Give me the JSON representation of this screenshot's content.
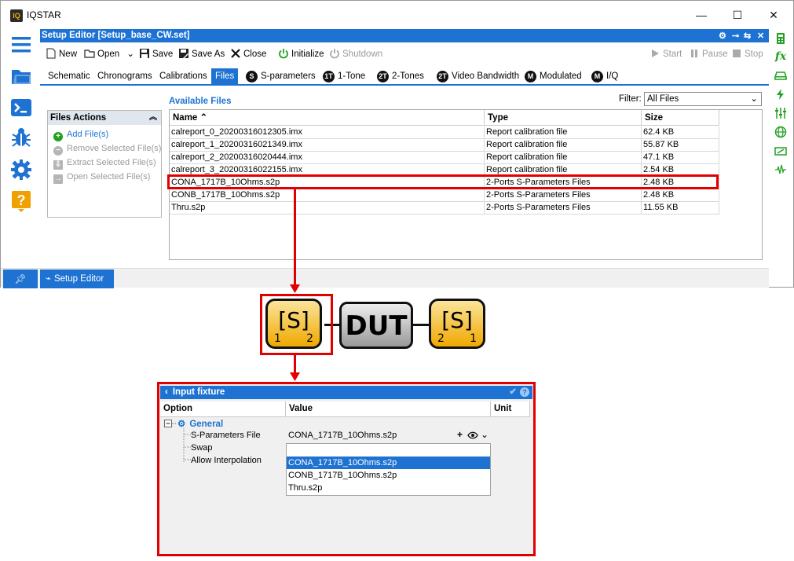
{
  "app": {
    "title": "IQSTAR",
    "logo": "IQ"
  },
  "window_controls": {
    "minimize": "—",
    "maximize": "☐",
    "close": "✕"
  },
  "editor": {
    "title": "Setup Editor [Setup_base_CW.set]",
    "toolbar": {
      "new": "New",
      "open": "Open",
      "save": "Save",
      "save_as": "Save As",
      "close": "Close",
      "initialize": "Initialize",
      "shutdown": "Shutdown",
      "start": "Start",
      "pause": "Pause",
      "stop": "Stop"
    },
    "tabs": [
      {
        "label": "Schematic",
        "badge": ""
      },
      {
        "label": "Chronograms",
        "badge": ""
      },
      {
        "label": "Calibrations",
        "badge": ""
      },
      {
        "label": "Files",
        "badge": ""
      },
      {
        "label": "S-parameters",
        "badge": "S"
      },
      {
        "label": "1-Tone",
        "badge": "1T"
      },
      {
        "label": "2-Tones",
        "badge": "2T"
      },
      {
        "label": "Video Bandwidth",
        "badge": "2T"
      },
      {
        "label": "Modulated",
        "badge": "M"
      },
      {
        "label": "I/Q",
        "badge": "M"
      }
    ],
    "active_tab": "Files"
  },
  "files_actions": {
    "title": "Files Actions",
    "items": [
      "Add File(s)",
      "Remove Selected File(s)",
      "Extract Selected File(s)",
      "Open Selected File(s)"
    ]
  },
  "available_files": {
    "title": "Available Files",
    "filter_label": "Filter:",
    "filter_value": "All Files",
    "columns": [
      "Name",
      "Type",
      "Size"
    ],
    "rows": [
      [
        "calreport_0_20200316012305.imx",
        "Report calibration file",
        "62.4 KB"
      ],
      [
        "calreport_1_20200316021349.imx",
        "Report calibration file",
        "55.87 KB"
      ],
      [
        "calreport_2_20200316020444.imx",
        "Report calibration file",
        "47.1 KB"
      ],
      [
        "calreport_3_20200316022155.imx",
        "Report calibration file",
        "2.54 KB"
      ],
      [
        "CONA_1717B_10Ohms.s2p",
        "2-Ports S-Parameters Files",
        "2.48 KB"
      ],
      [
        "CONB_1717B_10Ohms.s2p",
        "2-Ports S-Parameters Files",
        "2.48 KB"
      ],
      [
        "Thru.s2p",
        "2-Ports S-Parameters Files",
        "11.55 KB"
      ]
    ],
    "highlighted_row": 4
  },
  "statusbar": {
    "tab_label": "Setup Editor"
  },
  "diagram": {
    "left_block": "[S]",
    "left_ports": [
      "1",
      "2"
    ],
    "dut": "DUT",
    "right_block": "[S]",
    "right_ports": [
      "2",
      "1"
    ]
  },
  "input_fixture": {
    "title": "Input fixture",
    "columns": [
      "Option",
      "Value",
      "Unit"
    ],
    "group": "General",
    "options": [
      {
        "label": "S-Parameters File",
        "value": "CONA_1717B_10Ohms.s2p"
      },
      {
        "label": "Swap",
        "value": ""
      },
      {
        "label": "Allow Interpolation",
        "value": ""
      }
    ],
    "value_actions": "+",
    "dropdown": [
      "CONA_1717B_10Ohms.s2p",
      "CONB_1717B_10Ohms.s2p",
      "Thru.s2p"
    ],
    "dropdown_selected": 0
  },
  "colors": {
    "accent": "#1e73d2",
    "highlight": "#e00000",
    "green": "#1fa11f"
  }
}
